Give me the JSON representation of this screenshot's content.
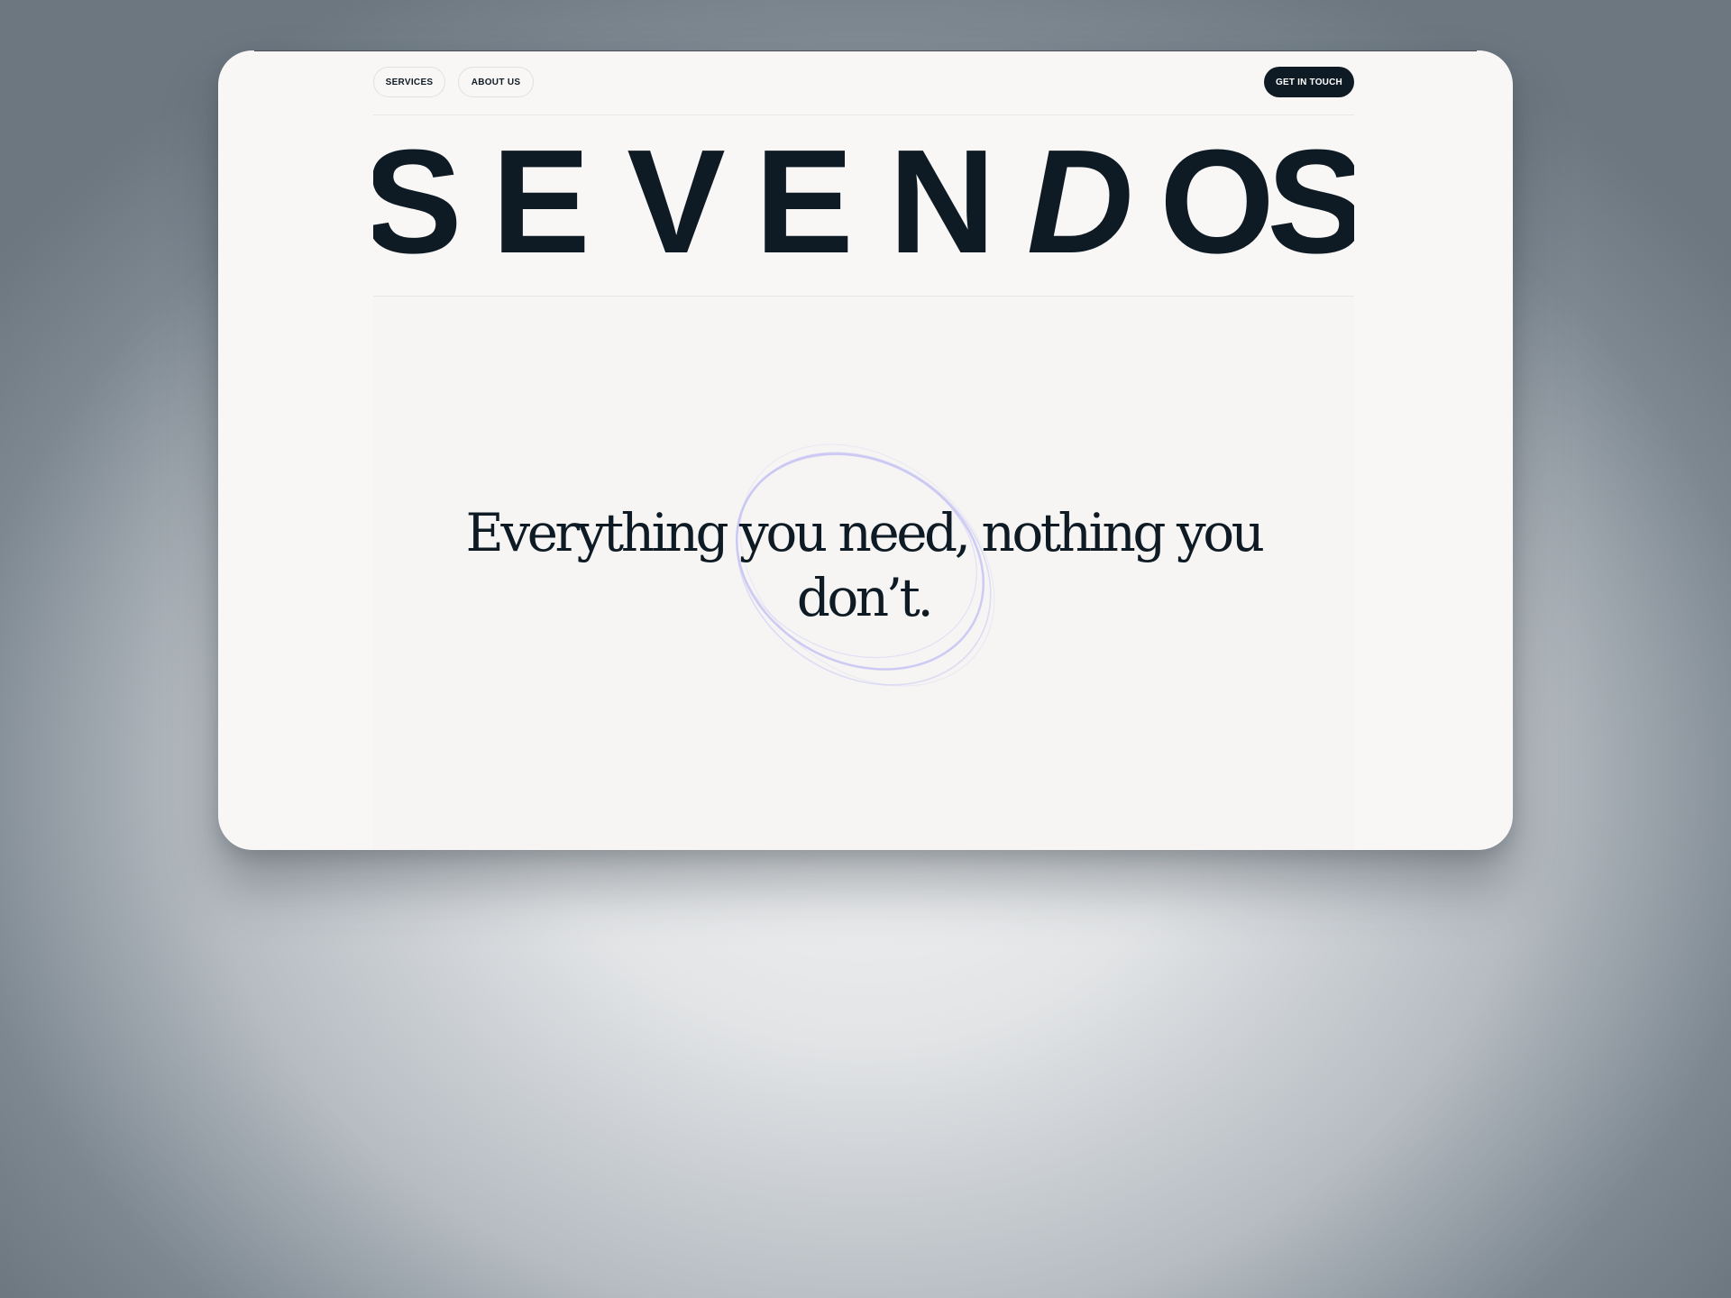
{
  "nav": {
    "links": [
      {
        "label": "SERVICES"
      },
      {
        "label": "ABOUT US"
      }
    ],
    "cta_label": "GET IN TOUCH"
  },
  "brand": {
    "letters": [
      "S",
      "E",
      "V",
      "E",
      "N",
      "D",
      "O",
      "S"
    ]
  },
  "hero": {
    "headline": "Everything you need, nothing you don’t."
  },
  "colors": {
    "ink": "#0f1b24",
    "page": "#f8f7f5",
    "scribble": "#c9c6f3"
  }
}
